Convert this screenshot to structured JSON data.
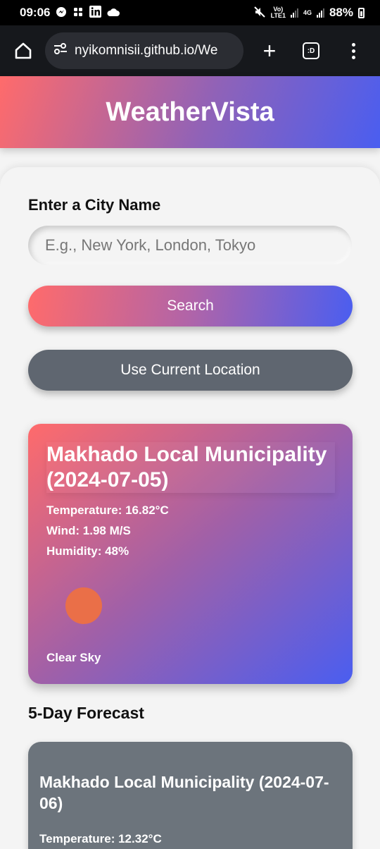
{
  "status_bar": {
    "time": "09:06",
    "network": "4G",
    "volte": "Vo)\nLTE1",
    "battery": "88%"
  },
  "browser": {
    "url": "nyikomnisii.github.io/We",
    "tabs_label": ":D"
  },
  "app": {
    "title": "WeatherVista"
  },
  "search": {
    "label": "Enter a City Name",
    "placeholder": "E.g., New York, London, Tokyo",
    "value": "",
    "search_button": "Search",
    "location_button": "Use Current Location"
  },
  "current": {
    "title": "Makhado Local Municipality (2024-07-05)",
    "temperature": "Temperature: 16.82°C",
    "wind": "Wind: 1.98 M/S",
    "humidity": "Humidity: 48%",
    "icon": "clear-sky-icon",
    "description": "Clear Sky"
  },
  "forecast": {
    "heading": "5-Day Forecast",
    "items": [
      {
        "title": "Makhado Local Municipality (2024-07-06)",
        "temperature": "Temperature: 12.32°C"
      }
    ]
  },
  "colors": {
    "gradient_start": "#ff6b6b",
    "gradient_end": "#4a5ef0",
    "secondary_button": "#5f6670",
    "forecast_card": "#6c747c"
  }
}
